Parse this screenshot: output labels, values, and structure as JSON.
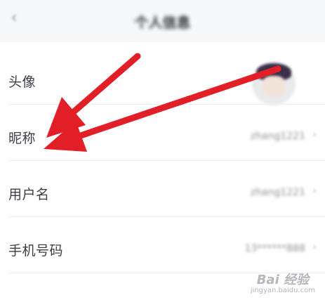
{
  "header": {
    "title": "个人信息",
    "back_icon": "back-arrow-icon"
  },
  "rows": [
    {
      "label": "头像",
      "type": "avatar"
    },
    {
      "label": "昵称",
      "value": "zhang1221"
    },
    {
      "label": "用户名",
      "value": "zhang1221"
    },
    {
      "label": "手机号码",
      "value": "13******888"
    }
  ],
  "chevron": "›",
  "watermark": {
    "line1": "Bai 经验",
    "line2": "jingyan.baidu.com"
  },
  "annotation": {
    "arrow_color": "#e21f26"
  }
}
